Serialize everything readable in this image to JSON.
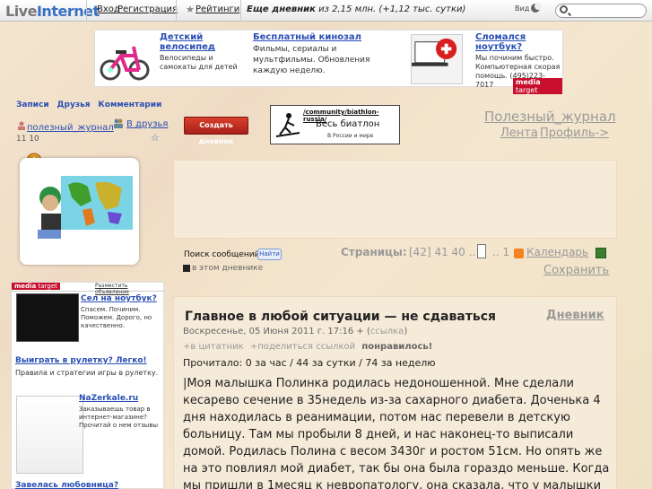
{
  "topbar": {
    "logo_part1": "Live",
    "logo_part2": "Internet",
    "login": "Вход",
    "register": "Регистрация",
    "ratings": "Рейтинги",
    "stats_link": "Еще дневник",
    "stats_rest": "из 2,15 млн. (+1,12 тыс. сутки)",
    "view_label": "Вид"
  },
  "ads": [
    {
      "title": "Детский велосипед",
      "text": "Велосипеды и самокаты для детей"
    },
    {
      "title": "Бесплатный кинозал",
      "text": "Фильмы, сериалы и мультфильмы. Обновления каждую неделю."
    },
    {
      "title": "Сломался ноутбук?",
      "text": "Мы починим быстро. Компьютерная скорая помощь. (495)223-7017"
    }
  ],
  "media_target": {
    "left": "media",
    "right": "target"
  },
  "nav": {
    "items": [
      "Записи",
      "Друзья",
      "Комментарии"
    ],
    "user": "полезный_журнал",
    "friends": "В друзья",
    "counts": "11 10"
  },
  "create_button": "Создать дневник",
  "biathlon": {
    "url": "/community/biathlon-russia/",
    "title": "Весь биатлон",
    "sub": "В России и мире"
  },
  "journal": {
    "title": "Полезный_журнал",
    "feed": "Лента",
    "profile": "Профиль->"
  },
  "search": {
    "label": "Поиск сообщений",
    "button": "Найти",
    "scope": "в этом дневнике"
  },
  "pagination": {
    "label": "Страницы:",
    "items": "[42] 41 40 ..",
    "tail": ".. 1",
    "calendar": "Календарь",
    "save": "Сохранить"
  },
  "left_ads": {
    "place": "Разместить объявление",
    "laptop_title": "Сел на ноутбук?",
    "laptop_text": "Спасем. Починим. Поможем. Дорого, но качественно.",
    "roulette_title": "Выиграть в рулетку? Легко!",
    "roulette_text": "Правила и стратегии игры в рулетку.",
    "mirror_title": "NaZerkale.ru",
    "mirror_text": "Заказываешь товар в интернет-магазине? Прочитай о нем отзывы",
    "lover_title": "Завелась любовница?"
  },
  "post": {
    "title": "Главное в любой ситуации — не сдаваться",
    "diary": "Дневник",
    "date": "Воскресенье, 05 Июня 2011 г. 17:16 +",
    "link": "ссылка",
    "actions": [
      "в цитатник",
      "+поделиться ссылкой",
      "понравилось!"
    ],
    "read": "Прочитало: 0 за час / 44 за сутки / 74 за неделю",
    "body": "|Моя малышка Полинка родилась недоношенной. Мне сделали кесарево сечение в 35недель из-за сахарного диабета. Доченька 4 дня находилась в реанимации, потом нас перевели в детскую больницу. Там мы пробыли 8 дней, и нас наконец-то выписали домой. Родилась Полина с весом 3430г и ростом 51см. Но опять же на это повлиял мой диабет, так бы она была гораздо меньше. Когда мы пришли в 1месяц к невропатологу, она сказала, что у малышки"
  }
}
